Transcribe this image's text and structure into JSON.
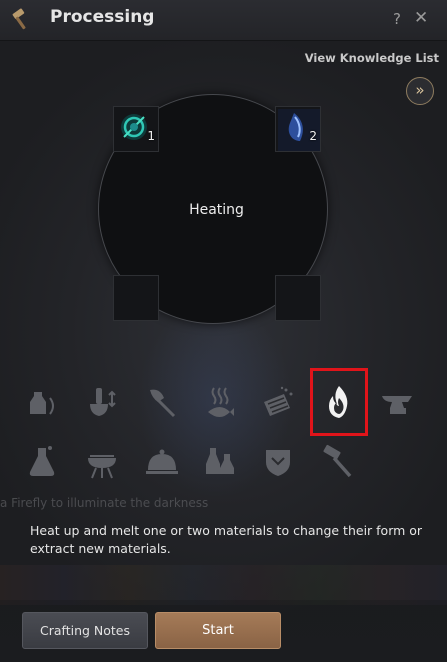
{
  "window": {
    "title": "Processing",
    "help_label": "?",
    "close_label": "✕",
    "title_icon": "hammer-icon"
  },
  "knowledge": {
    "link_label": "View Knowledge List",
    "expand_icon": "double-chevron-right-icon"
  },
  "processing": {
    "current_method": "Heating",
    "slots": [
      {
        "name": "material-slot-1",
        "count": "1",
        "item": "green-orb-icon"
      },
      {
        "name": "material-slot-2",
        "count": "2",
        "item": "blue-crystal-icon"
      },
      {
        "name": "material-slot-3",
        "count": "",
        "item": ""
      },
      {
        "name": "material-slot-4",
        "count": "",
        "item": ""
      }
    ]
  },
  "methods": {
    "row1": [
      "shaking",
      "grinding",
      "chopping",
      "drying",
      "filtering",
      "heating",
      "smithing"
    ],
    "row2": [
      "alchemy",
      "cooking",
      "imperial-cooking-delivery",
      "imperial-alchemy-delivery",
      "guild-production",
      "manufacture"
    ],
    "selected": "heating"
  },
  "description": "Heat up and melt one or two materials to change their form or extract new materials.",
  "background_text": "a Firefly to illuminate the darkness",
  "buttons": {
    "notes_label": "Crafting Notes",
    "start_label": "Start"
  },
  "colors": {
    "selection_highlight": "#e0141a",
    "start_button": "#9a7050",
    "accent_gold": "#d8c29b"
  }
}
